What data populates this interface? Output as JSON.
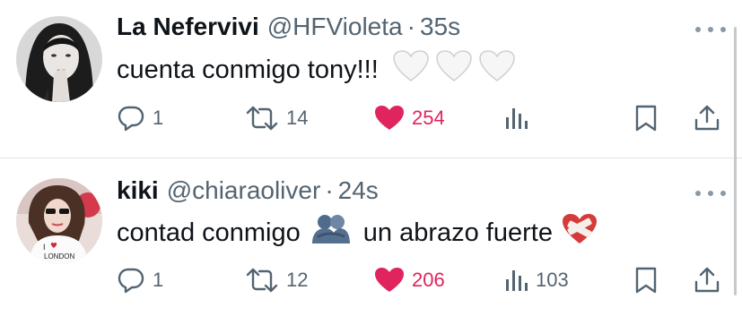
{
  "tweets": [
    {
      "author": {
        "display_name": "La Nefervivi",
        "handle": "@HFVioleta",
        "time": "35s",
        "avatar_icon": "profile-photo-dark-hair-hand-on-chin"
      },
      "text": "cuenta conmigo tony!!!",
      "emojis": [
        "white-heart-icon",
        "white-heart-icon",
        "white-heart-icon"
      ],
      "metrics": {
        "replies": "1",
        "retweets": "14",
        "likes": "254",
        "views": ""
      },
      "liked": true
    },
    {
      "author": {
        "display_name": "kiki",
        "handle": "@chiaraoliver",
        "time": "24s",
        "avatar_icon": "profile-photo-i-love-london-shirt"
      },
      "text_before": "contad conmigo",
      "text_after": "un abrazo fuerte",
      "emojis": [
        "people-hugging-icon",
        "mending-heart-icon"
      ],
      "metrics": {
        "replies": "1",
        "retweets": "12",
        "likes": "206",
        "views": "103"
      },
      "liked": true
    }
  ],
  "separator": "·",
  "colors": {
    "text": "#0f1419",
    "secondary": "#536471",
    "like": "#e0245e",
    "divider": "#dfe3e6"
  }
}
